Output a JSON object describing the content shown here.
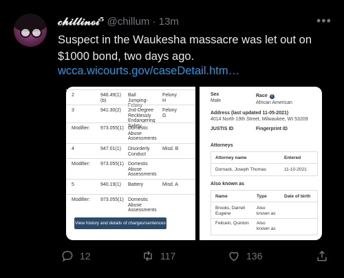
{
  "tweet": {
    "display_name": "𝓬𝓱𝓲𝓵𝓵𝓲𝓷𝓸𝓲⁵",
    "handle": "@chillum",
    "separator": "·",
    "time": "13m",
    "text": "Suspect in the Waukesha massacre was let out on $1000 bond, two days ago.",
    "link": "wcca.wicourts.gov/caseDetail.htm…"
  },
  "media_left": {
    "rows": [
      {
        "c1": "2",
        "c2": "946.49(1)\n(b)",
        "c3": "Bail\nJumping-\nFelony",
        "c4": "Felony\nH"
      },
      {
        "c1": "3",
        "c2": "941.30(2)",
        "c3": "2nd-Degree\nRecklessly\nEndangering\nSafety",
        "c4": "Felony\nG"
      },
      {
        "c1": "Modifier:",
        "c2": "973.055(1)",
        "c3": "Domestic\nAbuse\nAssessments",
        "c4": ""
      },
      {
        "c1": "4",
        "c2": "947.01(1)",
        "c3": "Disorderly\nConduct",
        "c4": "Misd. B"
      },
      {
        "c1": "Modifier:",
        "c2": "973.055(1)",
        "c3": "Domestic\nAbuse\nAssessments",
        "c4": ""
      },
      {
        "c1": "5",
        "c2": "940.19(1)",
        "c3": "Battery",
        "c4": "Misd. A"
      },
      {
        "c1": "Modifier:",
        "c2": "973.055(1)",
        "c3": "Domestic\nAbuse\nAssessments",
        "c4": ""
      }
    ],
    "button": "View history and details of charges/sentences"
  },
  "media_right": {
    "sex_label": "Sex",
    "sex_value": "Male",
    "race_label": "Race",
    "race_value": "African American",
    "address_label": "Address (last updated 11-05-2021)",
    "address_value": "4014 North 19th Street, Milwaukee, WI 53209",
    "justis_label": "JUSTIS ID",
    "fingerprint_label": "Fingerprint ID",
    "attorneys_title": "Attorneys",
    "attorney_col1": "Attorney name",
    "attorney_col2": "Entered",
    "attorney_name": "Dornack, Joseph Thomas",
    "attorney_entered": "11-10-2021",
    "aka_title": "Also known as",
    "aka_col1": "Name",
    "aka_col2": "Type",
    "aka_col3": "Date of birth",
    "aka_rows": [
      {
        "name": "Brooks, Darrell\nEugene",
        "type": "Also\nknown as"
      },
      {
        "name": "Feilcein, Quinton",
        "type": "Also\nknown as"
      }
    ]
  },
  "actions": {
    "replies": "12",
    "retweets": "117",
    "likes": "136"
  }
}
